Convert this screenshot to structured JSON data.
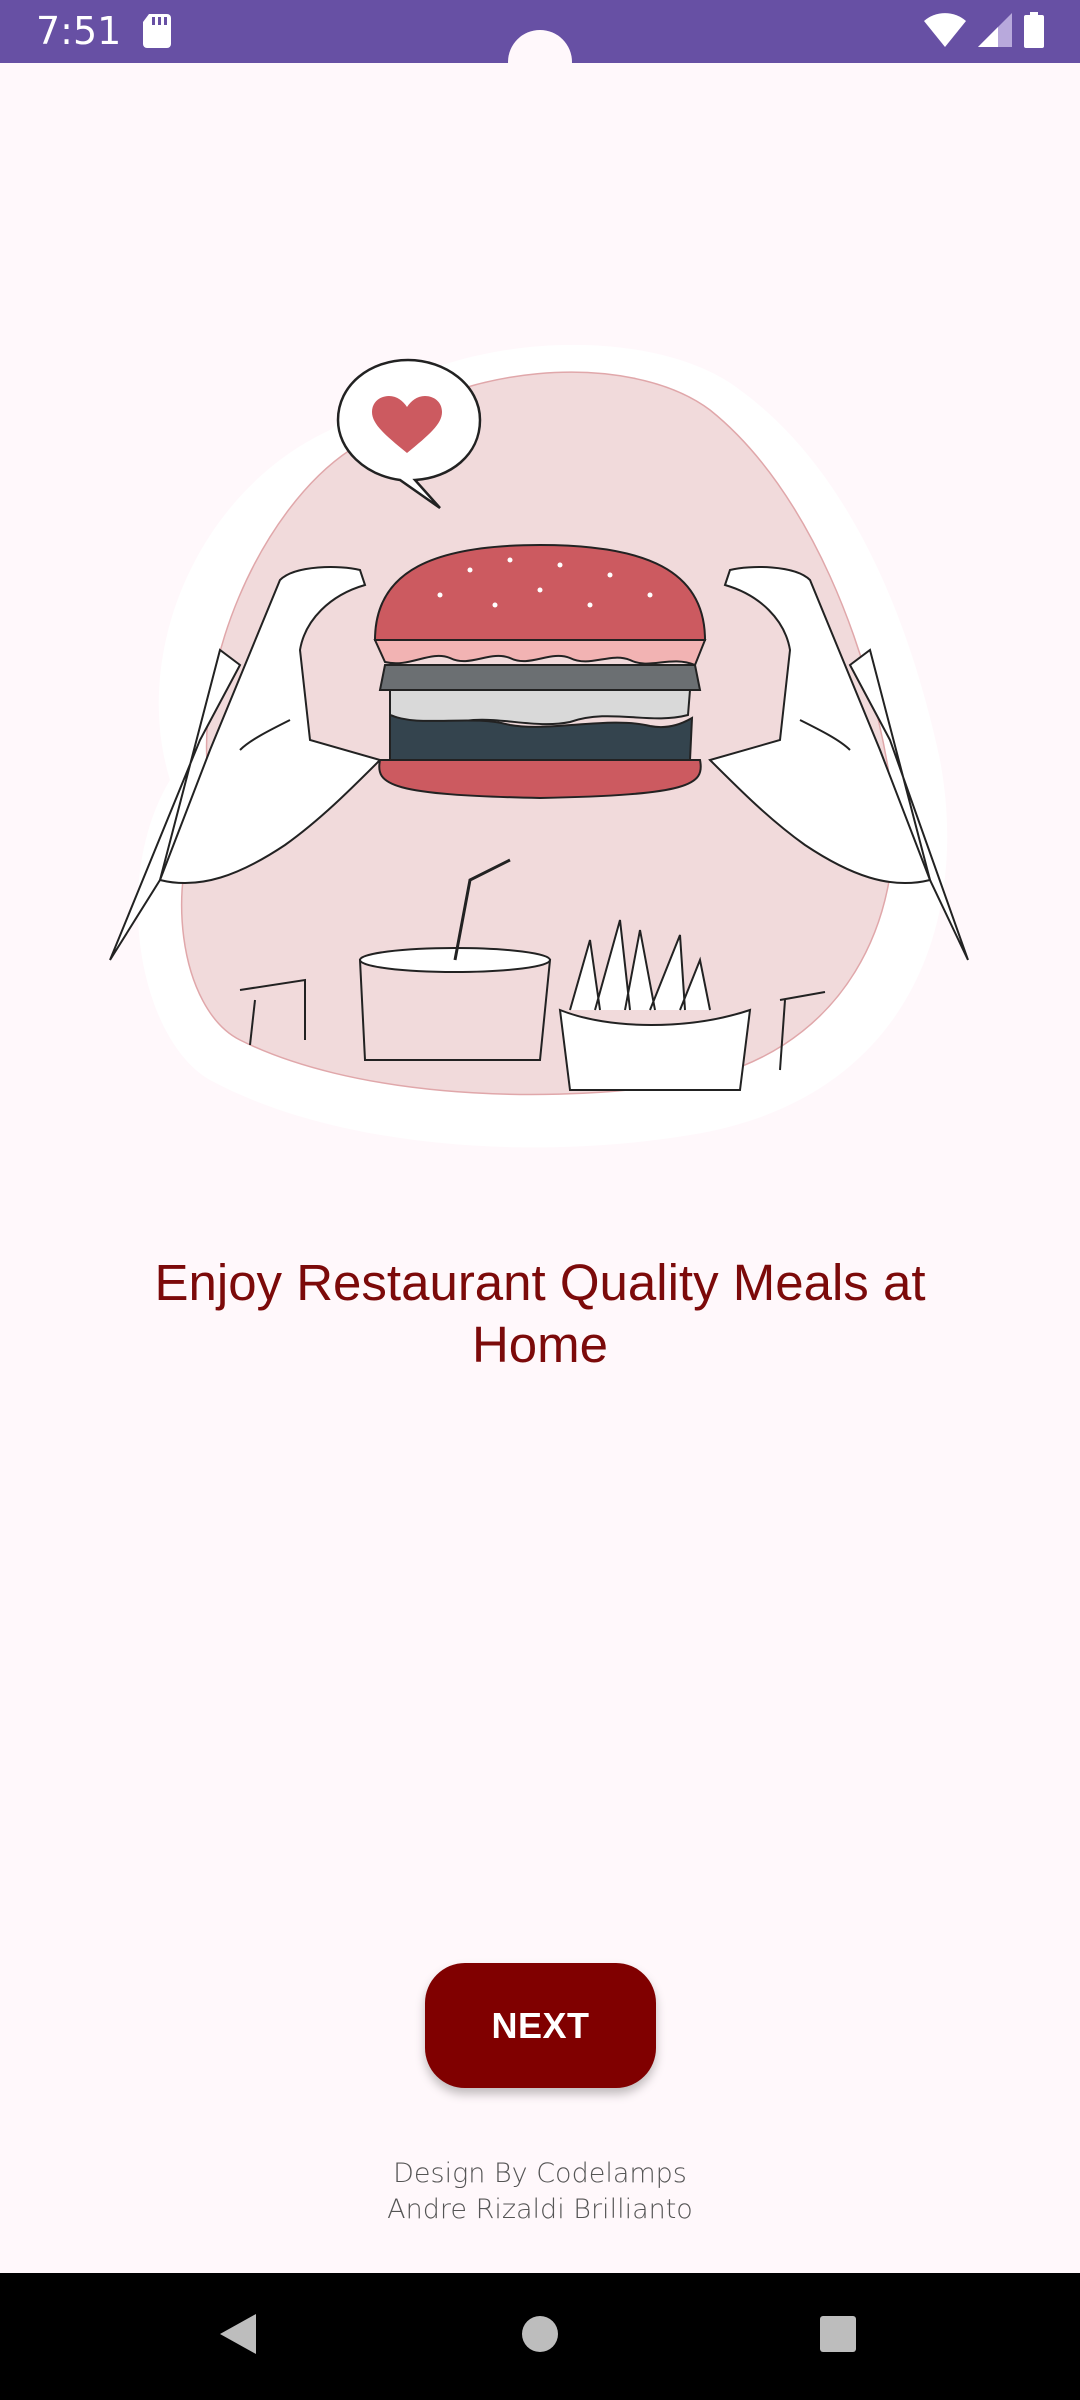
{
  "status_bar": {
    "time": "7:51",
    "icons": [
      "sd-card-icon",
      "wifi-icon",
      "cellular-signal-icon",
      "battery-icon"
    ],
    "background_color": "#6750a4"
  },
  "onboarding": {
    "illustration": "burger-hands-illustration",
    "headline": "Enjoy Restaurant Quality Meals at Home",
    "headline_color": "#7c0a0a"
  },
  "actions": {
    "next_label": "NEXT",
    "next_color": "#800000"
  },
  "credits": {
    "line1": "Design By Codelamps",
    "line2": "Andre Rizaldi Brillianto"
  },
  "nav_bar": {
    "buttons": [
      "back-icon",
      "home-icon",
      "recents-icon"
    ]
  }
}
